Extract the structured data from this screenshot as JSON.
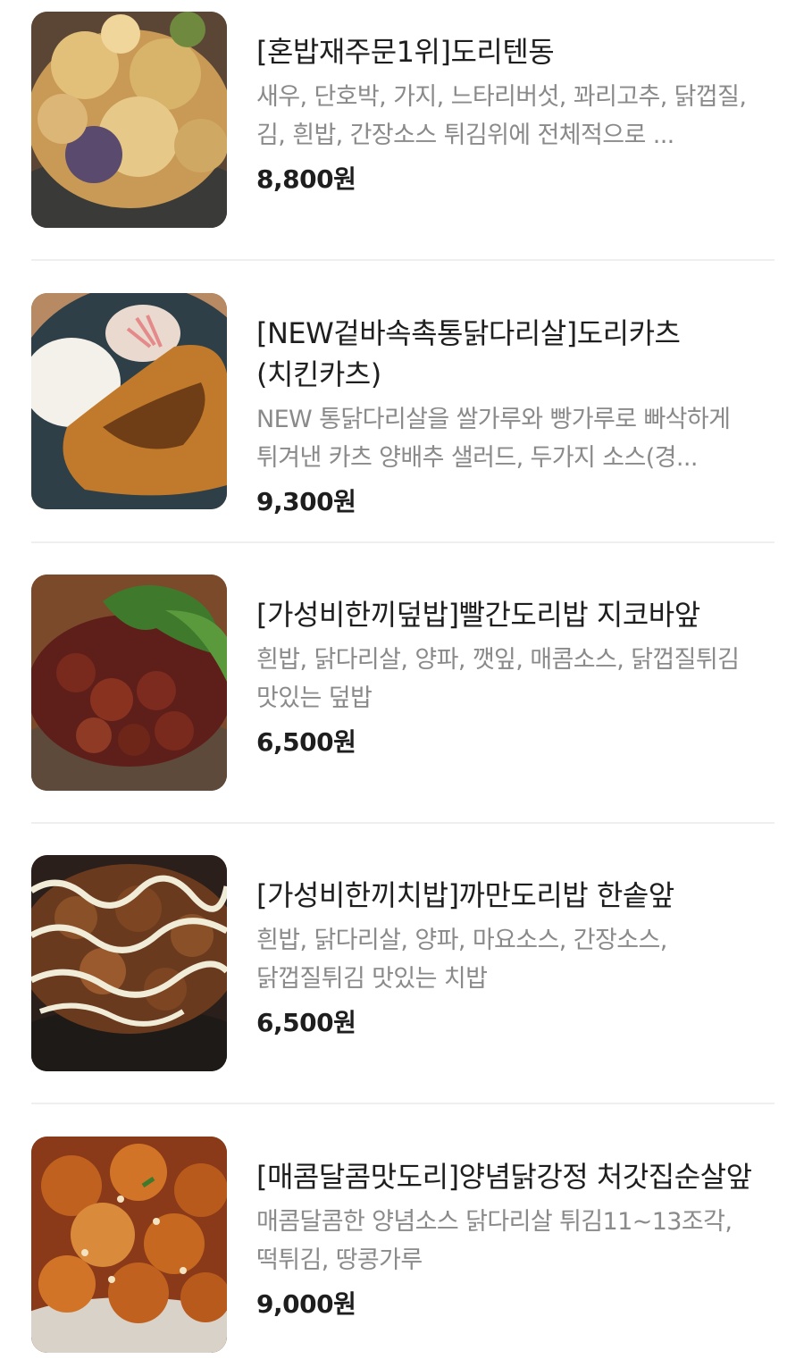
{
  "menu": {
    "items": [
      {
        "title": "[혼밥재주문1위]도리텐동",
        "description": "새우, 단호박, 가지, 느타리버섯, 꽈리고추, 닭껍질, 김, 흰밥, 간장소스 튀김위에 전체적으로 ...",
        "price": "8,800원",
        "image": "tempura-rice-bowl-photo"
      },
      {
        "title": "[NEW겉바속촉통닭다리살]도리카츠(치킨카츠)",
        "description": "NEW 통닭다리살을 쌀가루와 빵가루로 빠삭하게 튀겨낸 카츠 양배추 샐러드, 두가지 소스(경...",
        "price": "9,300원",
        "image": "chicken-katsu-plate-photo"
      },
      {
        "title": "[가성비한끼덮밥]빨간도리밥 지코바앞",
        "description": "흰밥, 닭다리살, 양파, 깻잎, 매콤소스, 닭껍질튀김 맛있는 덮밥",
        "price": "6,500원",
        "image": "spicy-chicken-rice-bowl-photo"
      },
      {
        "title": "[가성비한끼치밥]까만도리밥 한솥앞",
        "description": "흰밥, 닭다리살, 양파, 마요소스, 간장소스, 닭껍질튀김 맛있는 치밥",
        "price": "6,500원",
        "image": "mayo-chicken-rice-bowl-photo"
      },
      {
        "title": "[매콤달콤맛도리]양념닭강정 처갓집순살앞",
        "description": "매콤달콤한 양념소스 닭다리살 튀김11~13조각, 떡튀김, 땅콩가루",
        "price": "9,000원",
        "image": "sweet-spicy-fried-chicken-photo"
      }
    ]
  }
}
